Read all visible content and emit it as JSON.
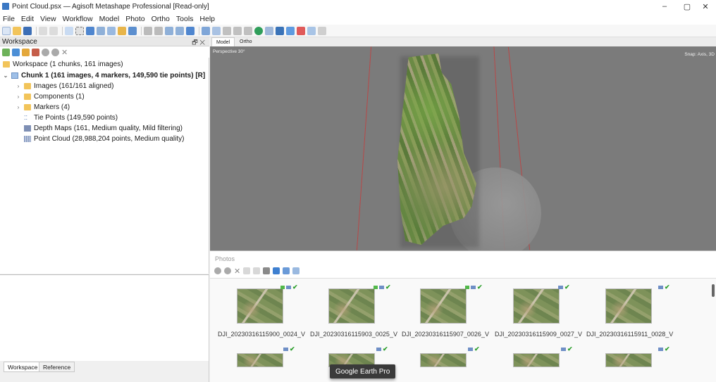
{
  "window": {
    "title": "Point Cloud.psx — Agisoft Metashape Professional [Read-only]",
    "controls": [
      "–",
      "▢",
      "✕"
    ]
  },
  "menu": [
    "File",
    "Edit",
    "View",
    "Workflow",
    "Model",
    "Photo",
    "Ortho",
    "Tools",
    "Help"
  ],
  "workspace_panel": {
    "title": "Workspace",
    "tree": {
      "root": "Workspace (1 chunks, 161 images)",
      "chunk": "Chunk 1 (161 images, 4 markers, 149,590 tie points) [R]",
      "items": [
        {
          "label": "Images (161/161 aligned)",
          "expandable": true,
          "icon": "folder-icon"
        },
        {
          "label": "Components (1)",
          "expandable": true,
          "icon": "folder-icon"
        },
        {
          "label": "Markers (4)",
          "expandable": true,
          "icon": "folder-icon"
        },
        {
          "label": "Tie Points (149,590 points)",
          "expandable": false,
          "icon": "tie-points-icon"
        },
        {
          "label": "Depth Maps (161, Medium quality, Mild filtering)",
          "expandable": false,
          "icon": "depth-maps-icon"
        },
        {
          "label": "Point Cloud (28,988,204 points, Medium quality)",
          "expandable": false,
          "icon": "point-cloud-icon"
        }
      ]
    },
    "bottom_tabs": [
      "Workspace",
      "Reference"
    ]
  },
  "view": {
    "tabs": [
      "Model",
      "Ortho"
    ],
    "perspective_label": "Perspective 30°",
    "snap_label": "Snap: Axis, 3D"
  },
  "photos_panel": {
    "title": "Photos",
    "photos": [
      "DJI_20230316115900_0024_V",
      "DJI_20230316115903_0025_V",
      "DJI_20230316115907_0026_V",
      "DJI_20230316115909_0027_V",
      "DJI_20230316115911_0028_V"
    ]
  },
  "tooltip": "Google Earth Pro",
  "colors": {
    "accent": "#3b78c4",
    "check": "#2c9f2c",
    "folder": "#f2c45a",
    "viewport_bg": "#7b7b7b"
  }
}
